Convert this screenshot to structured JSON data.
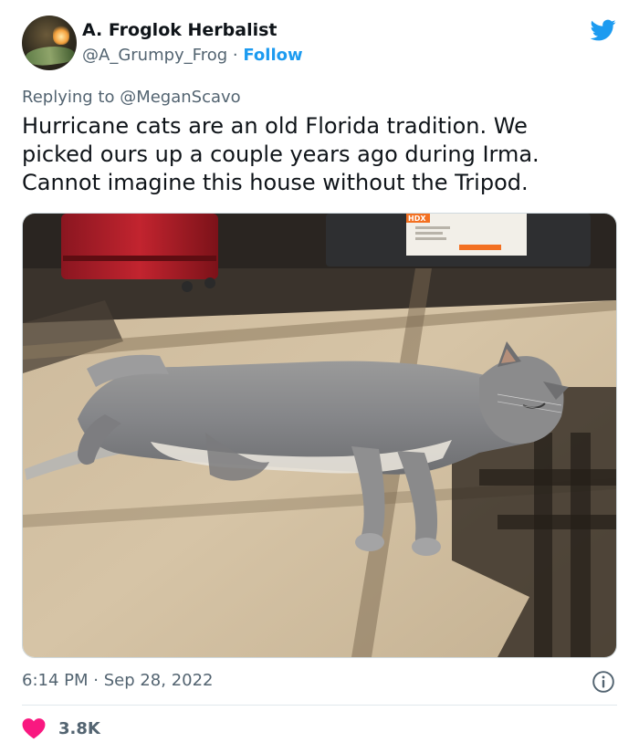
{
  "author": {
    "display_name": "A. Froglok Herbalist",
    "handle": "@A_Grumpy_Frog",
    "separator": " · ",
    "follow_label": "Follow"
  },
  "reply": {
    "prefix": "Replying to ",
    "mention": "@MeganScavo"
  },
  "tweet": {
    "text": "Hurricane cats are an old Florida tradition. We\npicked ours up a couple years ago during Irma.\nCannot imagine this house without the Tripod."
  },
  "media": {
    "alt": "Gray cat lying stretched out on a sunlit beige carpet",
    "box_label": "HDX"
  },
  "meta": {
    "time": "6:14 PM",
    "dot": " · ",
    "date": "Sep 28, 2022"
  },
  "engagement": {
    "like_count": "3.8K"
  },
  "colors": {
    "brand_blue": "#1d9bf0",
    "heart_red": "#f91880",
    "secondary_text": "#536471"
  },
  "icons": {
    "brand": "bird-icon",
    "info": "info-icon",
    "like": "heart-icon"
  }
}
